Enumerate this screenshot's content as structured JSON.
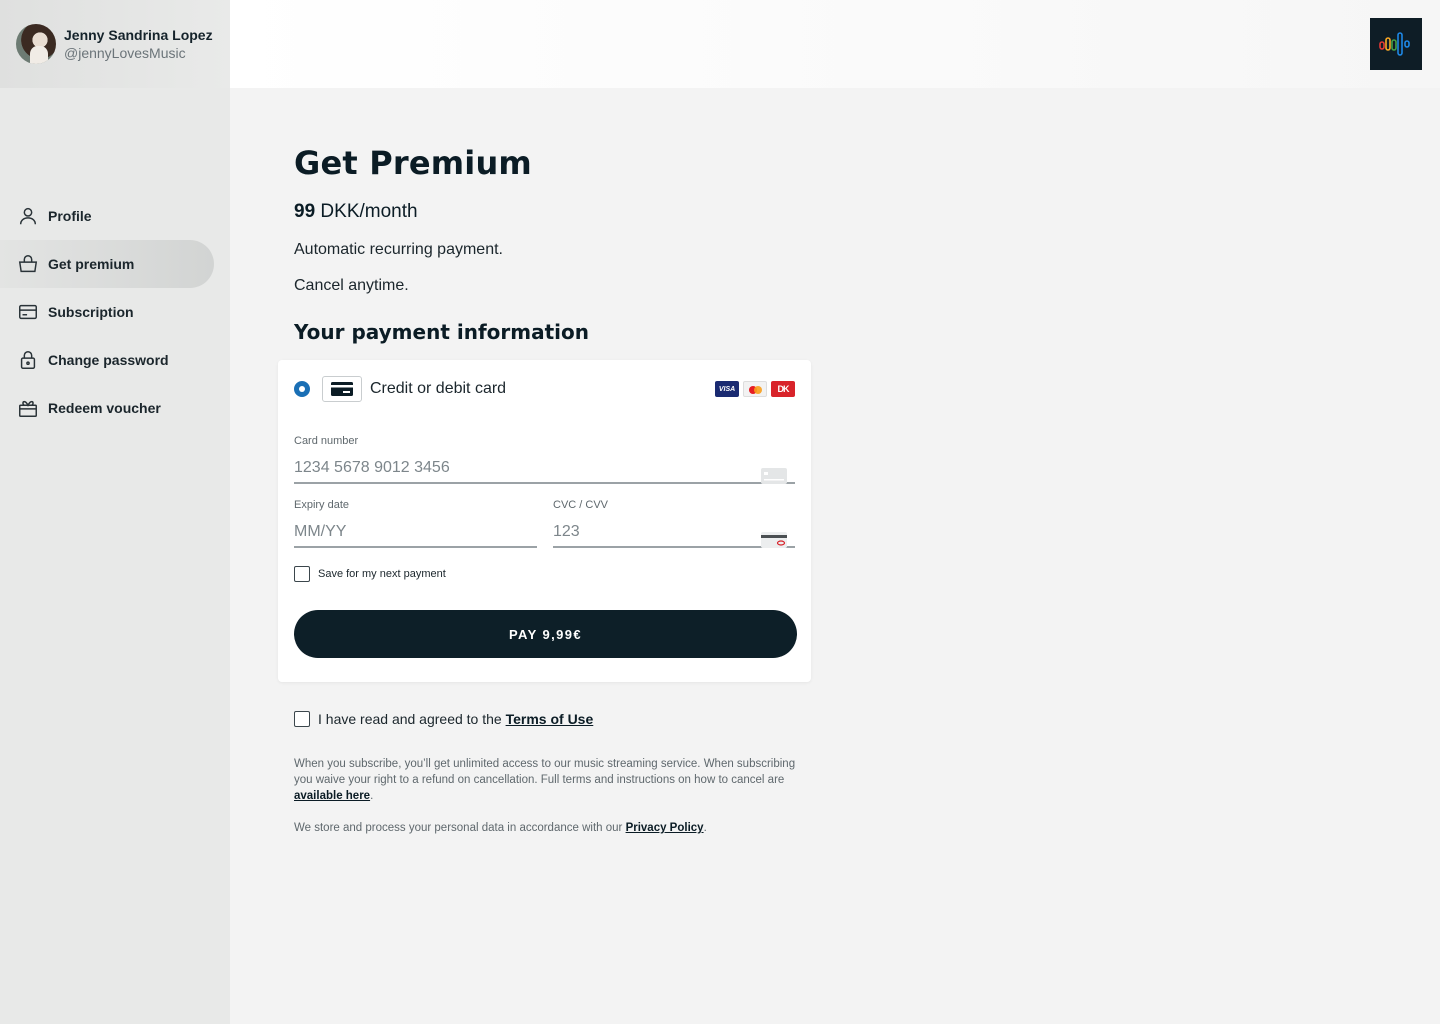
{
  "user": {
    "name": "Jenny Sandrina Lopez",
    "handle": "@jennyLovesMusic"
  },
  "sidebar": {
    "items": [
      {
        "label": "Profile",
        "icon": "person-icon",
        "active": false
      },
      {
        "label": "Get premium",
        "icon": "shopping-bag-icon",
        "active": true
      },
      {
        "label": "Subscription",
        "icon": "credit-card-icon",
        "active": false
      },
      {
        "label": "Change password",
        "icon": "lock-icon",
        "active": false
      },
      {
        "label": "Redeem voucher",
        "icon": "gift-icon",
        "active": false
      }
    ]
  },
  "header": {
    "logo_icon": "equalizer-logo-icon"
  },
  "main": {
    "title": "Get Premium",
    "price_amount": "99",
    "price_unit": "DKK/month",
    "note_recurring": "Automatic recurring payment.",
    "note_cancel": "Cancel anytime.",
    "section_title": "Your payment information"
  },
  "payment": {
    "method_label": "Credit or debit card",
    "brands": [
      "VISA",
      "Mastercard",
      "DK"
    ],
    "card_number_label": "Card number",
    "card_number_placeholder": "1234 5678 9012 3456",
    "expiry_label": "Expiry date",
    "expiry_placeholder": "MM/YY",
    "cvc_label": "CVC / CVV",
    "cvc_placeholder": "123",
    "save_label": "Save for my next payment",
    "pay_button": "PAY 9,99€"
  },
  "terms": {
    "prefix": "I have read and agreed to the ",
    "link": "Terms of Use"
  },
  "fineprint": {
    "p1_text": "When you subscribe, you’ll get unlimited access to our music streaming service. When subscribing you waive your right to a refund on cancellation. Full terms and instructions on how to cancel are ",
    "p1_link": "available here",
    "p1_end": ".",
    "p2_text": "We store and process your personal data in accordance with our ",
    "p2_link": "Privacy Policy",
    "p2_end": "."
  },
  "colors": {
    "primary_dark": "#0d1f28",
    "radio_blue": "#1a6fb5",
    "sidebar_bg": "#e8e9e8",
    "page_bg": "#f3f3f3"
  }
}
